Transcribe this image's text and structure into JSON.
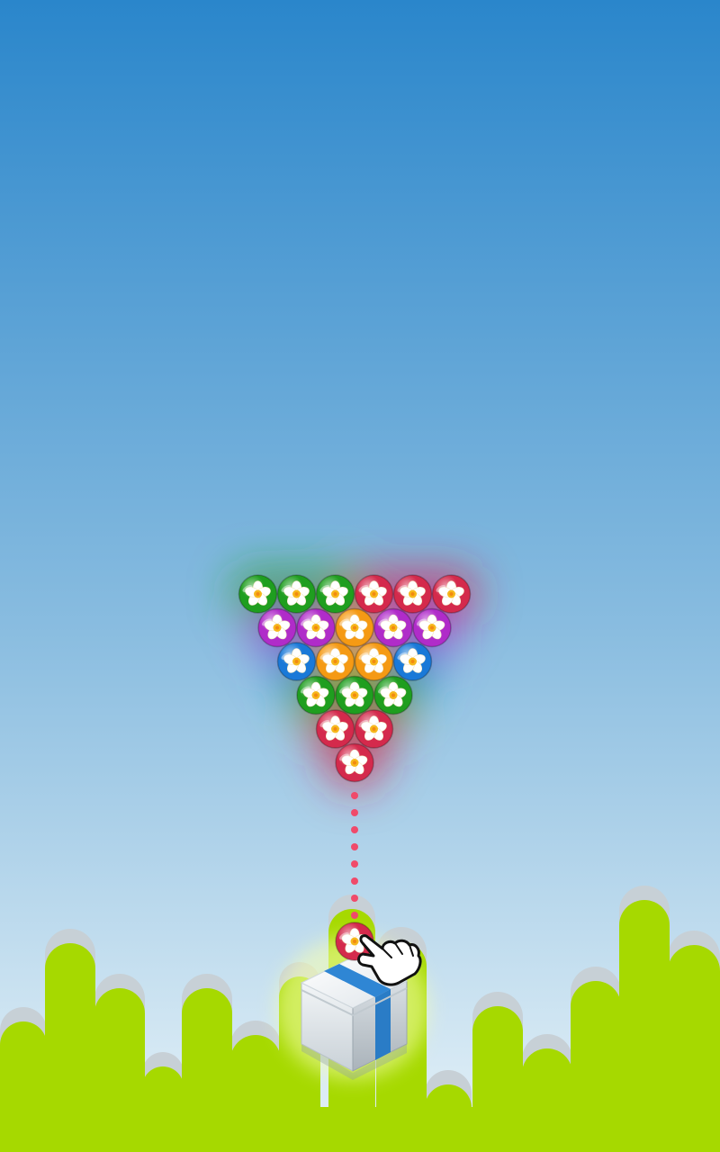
{
  "colors": {
    "sky_top": "#2a86cb",
    "sky_bottom": "#ddeef8",
    "ground": "#a6d900",
    "ground_shadow": "#c7d0d6",
    "aim_dot": "#f04a6a",
    "bubble_red": "#d42a4c",
    "bubble_green": "#1f9e1f",
    "bubble_purple": "#b02cc9",
    "bubble_orange": "#f59a14",
    "bubble_blue": "#1a79d8",
    "box_body": "#e7ecef",
    "box_ribbon": "#2f86d4"
  },
  "grid": {
    "rows": [
      [
        "green",
        "green",
        "green",
        "red",
        "red",
        "red"
      ],
      [
        "purple",
        "purple",
        "orange",
        "purple",
        "purple"
      ],
      [
        "blue",
        "orange",
        "orange",
        "blue"
      ],
      [
        "green",
        "green",
        "green"
      ],
      [
        "red",
        "red"
      ],
      [
        "red"
      ]
    ]
  },
  "shooter": {
    "current_bubble": "red",
    "aim_line": "vertical",
    "tutorial_hint": "hand-pointer-icon"
  },
  "icons": {
    "bubble": "flower-bubble-icon",
    "launcher": "gift-box-icon",
    "hint": "hand-pointer-icon"
  }
}
